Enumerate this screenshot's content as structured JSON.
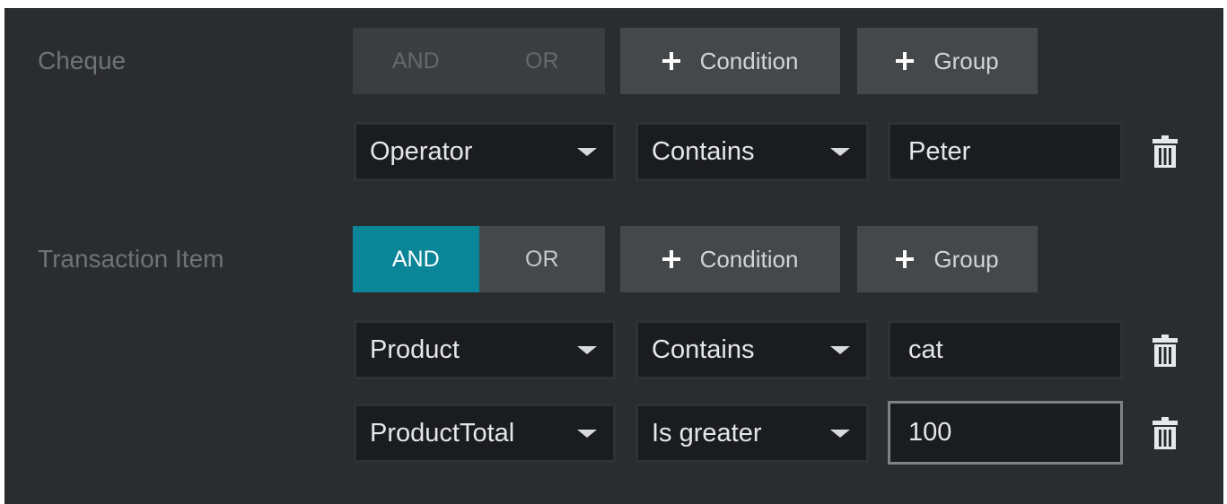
{
  "groups": [
    {
      "label": "Cheque",
      "logic": {
        "and_label": "AND",
        "or_label": "OR",
        "selected": "none",
        "enabled": false
      },
      "add_condition_label": "Condition",
      "add_group_label": "Group",
      "conditions": [
        {
          "field": "Operator",
          "operator": "Contains",
          "value": "Peter"
        }
      ]
    },
    {
      "label": "Transaction Item",
      "logic": {
        "and_label": "AND",
        "or_label": "OR",
        "selected": "AND",
        "enabled": true
      },
      "add_condition_label": "Condition",
      "add_group_label": "Group",
      "conditions": [
        {
          "field": "Product",
          "operator": "Contains",
          "value": "cat"
        },
        {
          "field": "ProductTotal",
          "operator": "Is greater",
          "value": "100"
        }
      ]
    }
  ],
  "icons": {
    "add": "plus-icon",
    "dropdown": "caret-down-icon",
    "delete": "trash-icon"
  },
  "colors": {
    "panel_bg": "#2b2c2e",
    "accent": "#0b8699",
    "button_bg": "#45484b",
    "input_bg": "#1b1c1e"
  }
}
